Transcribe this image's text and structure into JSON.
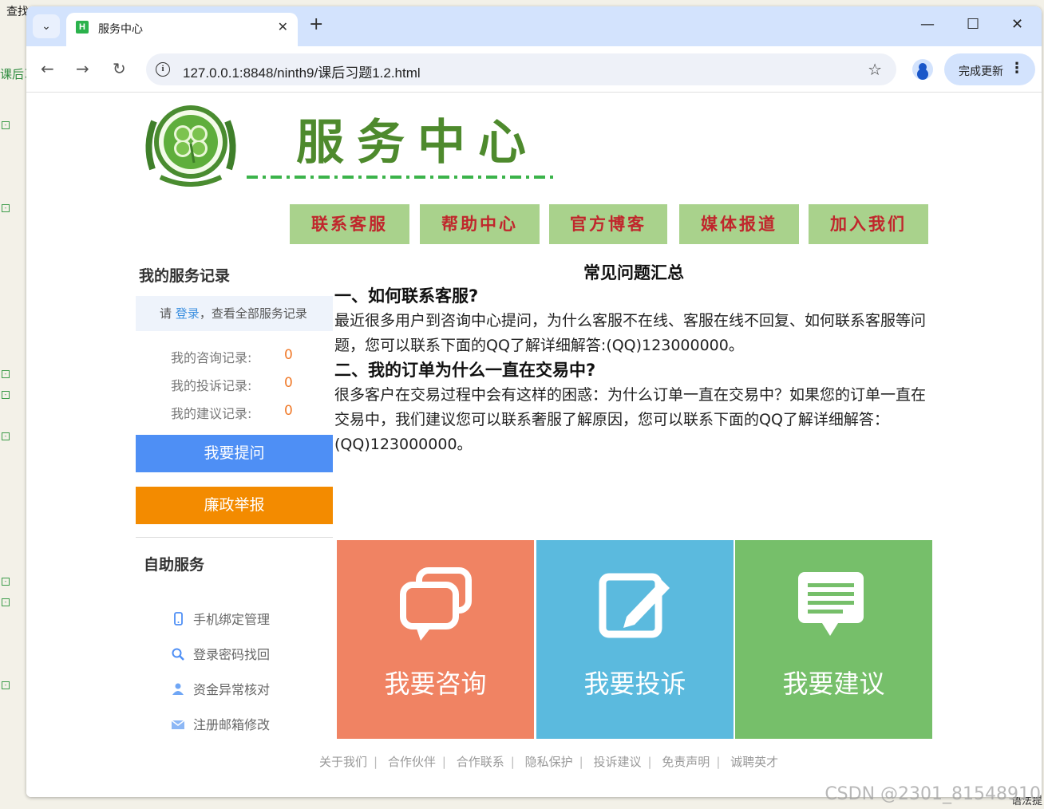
{
  "browser": {
    "tab_title": "服务中心",
    "url": "127.0.0.1:8848/ninth9/课后习题1.2.html",
    "update_label": "完成更新"
  },
  "background": {
    "menu_text": "查找",
    "side_text": "课后习",
    "corner_text": "语法提",
    "watermark": "CSDN @2301_81548910"
  },
  "header": {
    "site_title": "服务中心"
  },
  "nav": [
    "联系客服",
    "帮助中心",
    "官方博客",
    "媒体报道",
    "加入我们"
  ],
  "sidebar": {
    "title": "我的服务记录",
    "login_prefix": "请",
    "login_link": "登录",
    "login_suffix": "，查看全部服务记录",
    "records": [
      {
        "label": "我的咨询记录:",
        "value": "0"
      },
      {
        "label": "我的投诉记录:",
        "value": "0"
      },
      {
        "label": "我的建议记录:",
        "value": "0"
      }
    ],
    "ask_button": "我要提问",
    "report_button": "廉政举报",
    "self_service_title": "自助服务",
    "self_service_items": [
      {
        "label": "手机绑定管理",
        "icon": "phone-icon"
      },
      {
        "label": "登录密码找回",
        "icon": "search-icon"
      },
      {
        "label": "资金异常核对",
        "icon": "users-icon"
      },
      {
        "label": "注册邮箱修改",
        "icon": "mail-icon"
      }
    ]
  },
  "faq": {
    "title": "常见问题汇总",
    "items": [
      {
        "q": "一、如何联系客服?",
        "a": "最近很多用户到咨询中心提问，为什么客服不在线、客服在线不回复、如何联系客服等问题，您可以联系下面的QQ了解详细解答:(QQ)123000000。"
      },
      {
        "q": "二、我的订单为什么一直在交易中?",
        "a": "很多客户在交易过程中会有这样的困惑：为什么订单一直在交易中？如果您的订单一直在交易中，我们建议您可以联系奢服了解原因，您可以联系下面的QQ了解详细解答：(QQ)123000000。"
      }
    ]
  },
  "tiles": [
    {
      "label": "我要咨询",
      "color": "#f08363",
      "icon": "chat-icon"
    },
    {
      "label": "我要投诉",
      "color": "#5bbade",
      "icon": "edit-icon"
    },
    {
      "label": "我要建议",
      "color": "#76bf6a",
      "icon": "message-icon"
    }
  ],
  "footer": [
    "关于我们",
    "合作伙伴",
    "合作联系",
    "隐私保护",
    "投诉建议",
    "免责声明",
    "诚聘英才"
  ]
}
